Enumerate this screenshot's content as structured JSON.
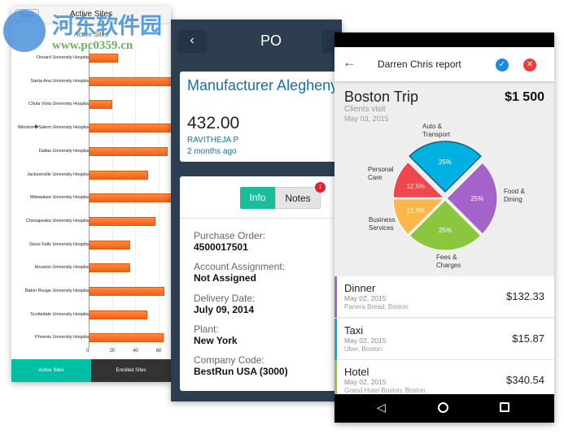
{
  "watermark": {
    "name": "河东软件园",
    "url": "www.pc0359.cn"
  },
  "left": {
    "back": "Back",
    "title": "Active Sites",
    "chart_title": "Active Sites",
    "tabs": [
      "Active Sites",
      "Enrolled Sites"
    ],
    "colors": {
      "active_tab": "#00bfa5",
      "inactive_tab": "#333333",
      "bar": "#f26522"
    }
  },
  "chart_data": [
    {
      "type": "bar",
      "orientation": "horizontal",
      "title": "Active Sites",
      "categories": [
        "Oxnard University Hospital",
        "Santa Ana University Hospital",
        "Chula Vista University Hospital",
        "Winston�Salem University Hospital",
        "Dallas University Hospital",
        "Jacksonville University Hospital",
        "Milwaukee University Hospital",
        "Chesapeake University Hospital",
        "Sioux Falls University Hospital",
        "Houston University Hospital",
        "Baton Rouge University Hospital",
        "Scottsdale University Hospital",
        "Phoenix University Hospital"
      ],
      "values": [
        25,
        72,
        20,
        72,
        68,
        51,
        72,
        57,
        36,
        36,
        65,
        50,
        64
      ],
      "xticks": [
        "0",
        "20",
        "40",
        "60"
      ],
      "xlim": [
        0,
        70
      ],
      "grid": true
    },
    {
      "type": "pie",
      "categories": [
        "Auto & Transport",
        "Food & Dining",
        "Fees & Charges",
        "Business Services",
        "Personal Care"
      ],
      "values": [
        25,
        25,
        25,
        12.5,
        12.5
      ],
      "labels": [
        "25%",
        "25%",
        "25%",
        "12,5%",
        "12,5%"
      ],
      "colors": [
        "#00b0e0",
        "#a463c8",
        "#8cc63f",
        "#fbb848",
        "#f0474c"
      ],
      "exploded": "Auto & Transport"
    }
  ],
  "mid": {
    "title": "PO",
    "back": "‹",
    "vendor": "Manufacturer Alegheny Ludlum Steel",
    "amount": "432.00",
    "user": "RAVITHEJA P",
    "time": "2 months ago",
    "tabs": [
      "Info",
      "Notes"
    ],
    "notes_badge": "1",
    "fields": [
      {
        "label": "Purchase Order:",
        "value": "4500017501"
      },
      {
        "label": "Account Assignment:",
        "value": "Not Assigned"
      },
      {
        "label": "Delivery Date:",
        "value": "July 09, 2014"
      },
      {
        "label": "Plant:",
        "value": "New York"
      },
      {
        "label": "Company Code:",
        "value": "BestRun USA (3000)"
      }
    ]
  },
  "right": {
    "title": "Darren Chris report",
    "trip": "Boston Trip",
    "total": "$1 500",
    "subtitle": "Clients visit",
    "date": "May 03, 2015",
    "items": [
      {
        "name": "Dinner",
        "date": "May 02, 2015",
        "place": "Panera Bread, Boston",
        "amount": "$132.33",
        "color": "#a463c8"
      },
      {
        "name": "Taxi",
        "date": "May 02, 2015",
        "place": "Uber, Boston",
        "amount": "$15.87",
        "color": "#00b0e0"
      },
      {
        "name": "Hotel",
        "date": "May 02, 2015",
        "place": "Grand Hotel Boston, Boston",
        "amount": "$340.54",
        "color": "#8cc63f"
      }
    ]
  }
}
